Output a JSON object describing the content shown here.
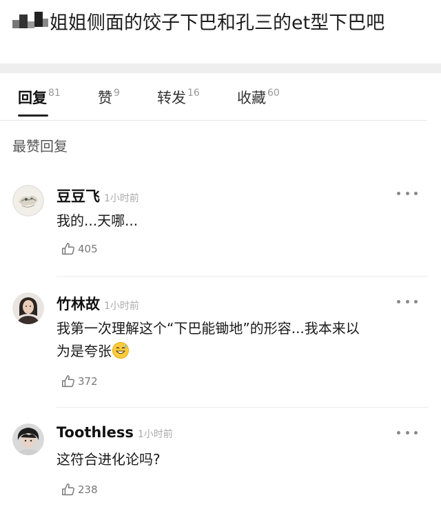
{
  "post": {
    "text": "姐姐侧面的饺子下巴和孔三的et型下巴吧"
  },
  "tabs": [
    {
      "label": "回复",
      "count": "81"
    },
    {
      "label": "赞",
      "count": "9"
    },
    {
      "label": "转发",
      "count": "16"
    },
    {
      "label": "收藏",
      "count": "60"
    }
  ],
  "section_title": "最赞回复",
  "comments": [
    {
      "name": "豆豆飞",
      "time": "1小时前",
      "text": "我的...天哪...",
      "likes": "405"
    },
    {
      "name": "竹林故",
      "time": "1小时前",
      "text_line1": "我第一次理解这个“下巴能锄地”的形容...我本来以",
      "text_line2": "为是夸张",
      "likes": "372"
    },
    {
      "name": "Toothless",
      "time": "1小时前",
      "text": "这符合进化论吗?",
      "likes": "238"
    }
  ],
  "icons": {
    "like": "thumbs-up-icon",
    "more": "more-dots-icon",
    "emoji": "sweat-smile-emoji-icon"
  },
  "colors": {
    "separator_band": "#eeeeee",
    "muted_text": "#999999"
  }
}
